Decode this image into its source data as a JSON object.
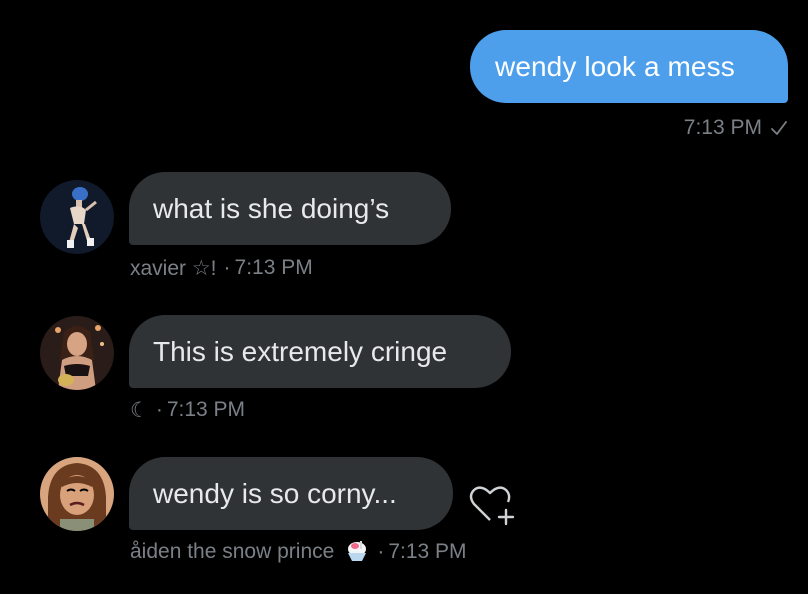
{
  "sent": {
    "text": "wendy look a mess",
    "time": "7:13 PM",
    "status_icon": "check-icon",
    "bubble_color": "#4d9fec"
  },
  "messages": [
    {
      "text": "what is she doing’s",
      "sender": "xavier ☆!",
      "separator": "·",
      "time": "7:13 PM",
      "avatar_icon": "performer-avatar"
    },
    {
      "text": "This is extremely cringe",
      "sender": "☾",
      "separator": "·",
      "time": "7:13 PM",
      "avatar_icon": "singer-avatar"
    },
    {
      "text": "wendy is so corny...",
      "sender": "åiden the snow prince",
      "sender_emoji": "shaved-ice-emoji",
      "separator": "·",
      "time": "7:13 PM",
      "avatar_icon": "cartoon-avatar",
      "action_icon": "heart-plus-icon"
    }
  ],
  "colors": {
    "background": "#000000",
    "received_bubble": "#2f3336",
    "meta_text": "#7b8087"
  }
}
